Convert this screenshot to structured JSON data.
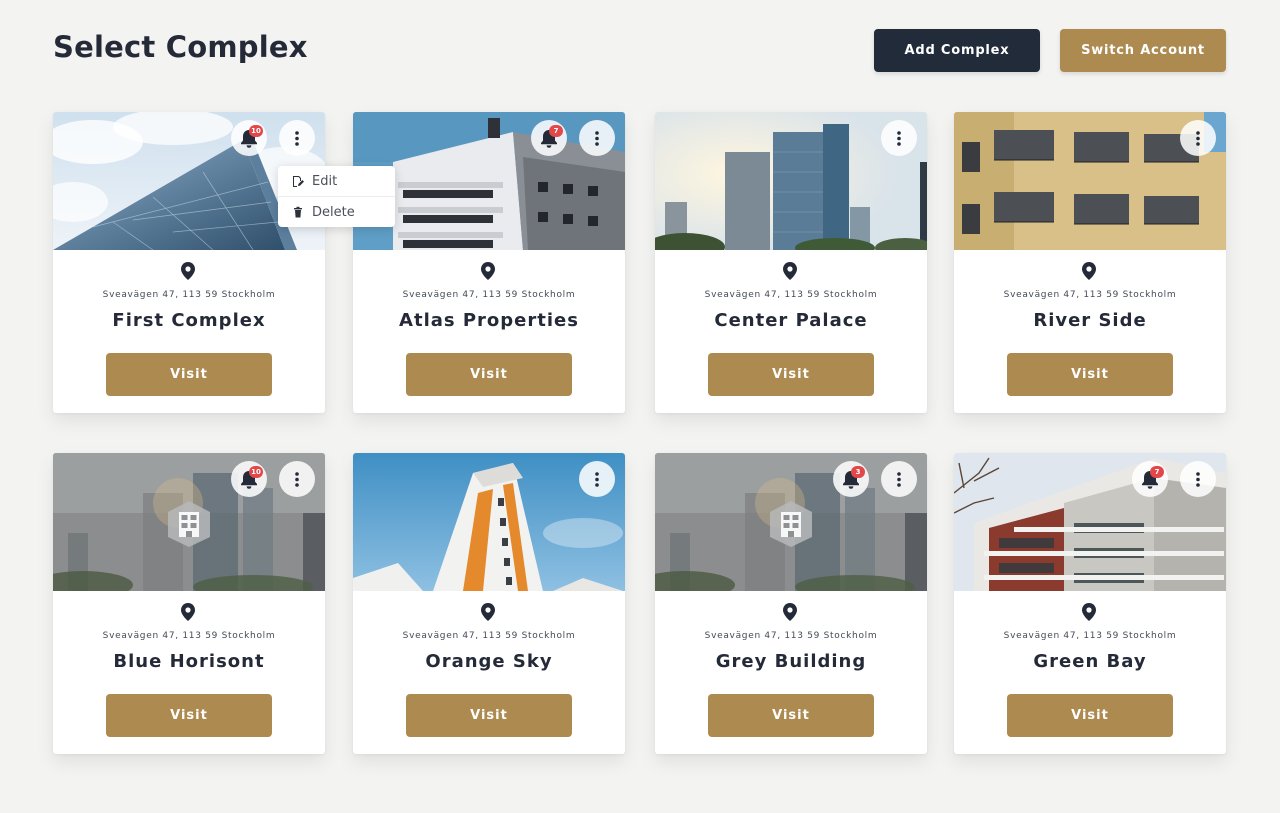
{
  "header": {
    "title": "Select Complex",
    "add_complex_label": "Add Complex",
    "switch_account_label": "Switch Account"
  },
  "context_menu": {
    "edit_label": "Edit",
    "delete_label": "Delete"
  },
  "colors": {
    "accent_gold": "#ad8a4f",
    "dark_navy": "#222b3a",
    "badge_red": "#e2474a"
  },
  "complexes": [
    {
      "name": "First Complex",
      "address": "Sveavägen 47, 113 59 Stockholm",
      "notifications": "10",
      "visit_label": "Visit"
    },
    {
      "name": "Atlas Properties",
      "address": "Sveavägen 47, 113 59 Stockholm",
      "notifications": "7",
      "visit_label": "Visit"
    },
    {
      "name": "Center Palace",
      "address": "Sveavägen 47, 113 59 Stockholm",
      "visit_label": "Visit"
    },
    {
      "name": "River Side",
      "address": "Sveavägen 47, 113 59 Stockholm",
      "visit_label": "Visit"
    },
    {
      "name": "Blue Horisont",
      "address": "Sveavägen 47, 113 59 Stockholm",
      "notifications": "10",
      "visit_label": "Visit"
    },
    {
      "name": "Orange Sky",
      "address": "Sveavägen 47, 113 59 Stockholm",
      "visit_label": "Visit"
    },
    {
      "name": "Grey Building",
      "address": "Sveavägen 47, 113 59 Stockholm",
      "notifications": "3",
      "visit_label": "Visit"
    },
    {
      "name": "Green Bay",
      "address": "Sveavägen 47, 113 59 Stockholm",
      "notifications": "7",
      "visit_label": "Visit"
    }
  ]
}
